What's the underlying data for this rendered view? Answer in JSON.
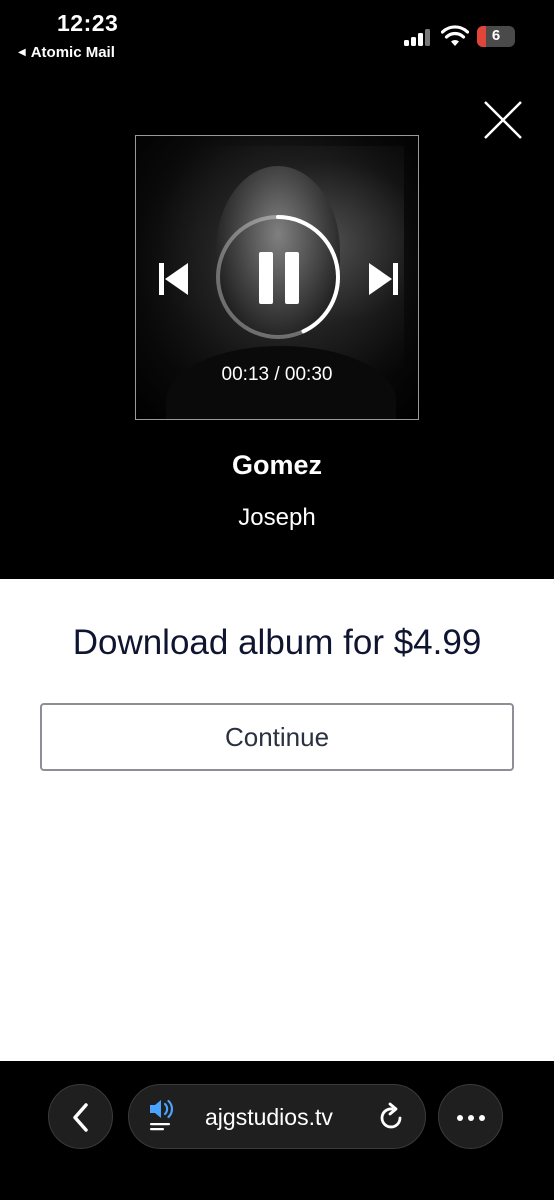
{
  "status_bar": {
    "time": "12:23",
    "back_app": "Atomic Mail",
    "battery": "6",
    "battery_color": "#e0453a"
  },
  "player": {
    "elapsed_total": "00:13 / 00:30",
    "progress": 0.43,
    "title": "Gomez",
    "artist": "Joseph"
  },
  "purchase": {
    "offer": "Download album for $4.99",
    "continue_label": "Continue"
  },
  "browser": {
    "url": "ajgstudios.tv",
    "accent": "#4aa3ff"
  },
  "icons": [
    "close-icon",
    "previous-track-icon",
    "pause-icon",
    "next-track-icon",
    "back-chevron-icon",
    "speaker-icon",
    "reload-icon",
    "more-icon"
  ]
}
